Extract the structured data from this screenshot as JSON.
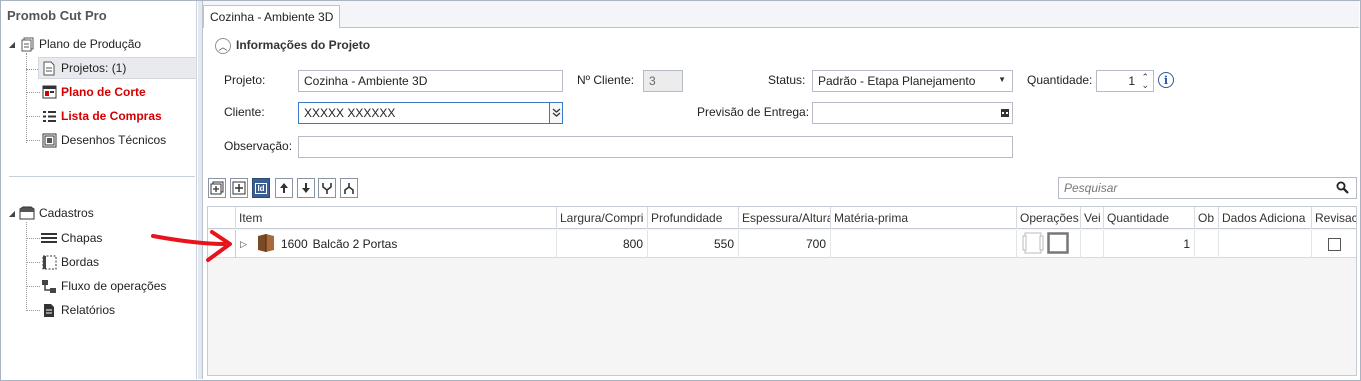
{
  "app": {
    "title": "Promob Cut Pro"
  },
  "sidebar": {
    "production": {
      "label": "Plano de Produção",
      "items": [
        {
          "label": "Projetos: (1)",
          "selected": true
        },
        {
          "label": "Plano de Corte",
          "highlight": true
        },
        {
          "label": "Lista de Compras",
          "highlight": true
        },
        {
          "label": "Desenhos Técnicos"
        }
      ]
    },
    "registry": {
      "label": "Cadastros",
      "items": [
        {
          "label": "Chapas"
        },
        {
          "label": "Bordas"
        },
        {
          "label": "Fluxo de operações"
        },
        {
          "label": "Relatórios"
        }
      ]
    }
  },
  "tab": {
    "label": "Cozinha - Ambiente 3D"
  },
  "project_info": {
    "section_title": "Informações do Projeto",
    "project_label": "Projeto:",
    "project_value": "Cozinha - Ambiente 3D",
    "client_no_label": "Nº Cliente:",
    "client_no_value": "3",
    "status_label": "Status:",
    "status_value": "Padrão - Etapa Planejamento",
    "quantity_label": "Quantidade:",
    "quantity_value": "1",
    "client_label": "Cliente:",
    "client_value": "XXXXX XXXXXX",
    "delivery_label": "Previsão de Entrega:",
    "delivery_value": "",
    "notes_label": "Observação:",
    "notes_value": ""
  },
  "search": {
    "placeholder": "Pesquisar"
  },
  "grid": {
    "columns": [
      "Item",
      "Largura/Compri",
      "Profundidade",
      "Espessura/Altura",
      "Matéria-prima",
      "Operações",
      "Vei",
      "Quantidade",
      "Ob",
      "Dados Adiciona",
      "Revisac"
    ],
    "rows": [
      {
        "code": "1600",
        "name": "Balcão 2 Portas",
        "width": "800",
        "depth": "550",
        "thickness": "700",
        "material": "",
        "quantity": "1",
        "revision_checked": false
      }
    ]
  },
  "colors": {
    "accent_red": "#d40000",
    "arrow_red": "#e8141c",
    "selected_button": "#3a5f93"
  }
}
